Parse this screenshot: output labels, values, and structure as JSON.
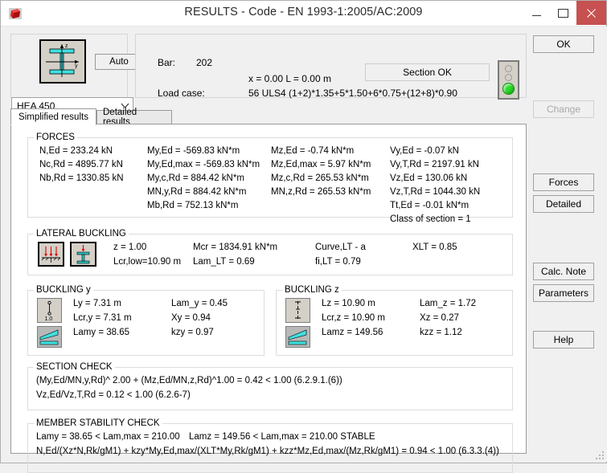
{
  "window": {
    "title": "RESULTS - Code - EN 1993-1:2005/AC:2009",
    "app_icon": "robot-structural-icon",
    "minimize": "—",
    "maximize": "▢",
    "close": "✕"
  },
  "section": {
    "profile_icon": "i-beam-section-icon",
    "auto_label": "Auto",
    "profile_value": "HEA 450",
    "chevron": "⌄"
  },
  "bar_info": {
    "bar_label": "Bar:",
    "bar_value": "202",
    "position": "x = 0.00 L = 0.00 m",
    "load_case_label": "Load case:",
    "load_case_value": "56 ULS4  (1+2)*1.35+5*1.50+6*0.75+(12+8)*0.90",
    "status": "Section OK",
    "traffic_light": "green"
  },
  "tabs": [
    {
      "label": "Simplified results",
      "active": true
    },
    {
      "label": "Detailed results",
      "active": false
    }
  ],
  "forces": {
    "title": "FORCES",
    "col1": [
      "N,Ed = 233.24 kN",
      "Nc,Rd = 4895.77 kN",
      "Nb,Rd = 1330.85 kN"
    ],
    "col2": [
      "My,Ed = -569.83 kN*m",
      "My,Ed,max = -569.83 kN*m",
      "My,c,Rd = 884.42 kN*m",
      "MN,y,Rd = 884.42 kN*m",
      "Mb,Rd = 752.13 kN*m"
    ],
    "col3": [
      "Mz,Ed = -0.74 kN*m",
      "Mz,Ed,max = 5.97 kN*m",
      "Mz,c,Rd = 265.53 kN*m",
      "MN,z,Rd = 265.53 kN*m"
    ],
    "col4": [
      "Vy,Ed = -0.07 kN",
      "Vy,T,Rd = 2197.91 kN",
      "Vz,Ed = 130.06 kN",
      "Vz,T,Rd = 1044.30 kN",
      "Tt,Ed = -0.01 kN*m",
      "Class of section = 1"
    ]
  },
  "lateral_buckling": {
    "title": "LATERAL BUCKLING",
    "icon_left": "lateral-load-diagram-icon",
    "icon_right": "i-section-restraint-icon",
    "col1": [
      "z = 1.00",
      "Lcr,low=10.90 m"
    ],
    "col2": [
      "Mcr = 1834.91 kN*m",
      "Lam_LT = 0.69"
    ],
    "col3": [
      "Curve,LT - a",
      "fi,LT = 0.79"
    ],
    "col4": [
      "XLT = 0.85"
    ]
  },
  "buckling_y": {
    "title": "BUCKLING y",
    "icon_top": "buckling-length-coefficient-icon",
    "icon_bottom": "buckling-moment-diagram-icon",
    "col1": [
      "Ly = 7.31 m",
      "Lcr,y = 7.31 m",
      "Lamy = 38.65"
    ],
    "col2": [
      "Lam_y = 0.45",
      "Xy = 0.94",
      "kzy = 0.97"
    ]
  },
  "buckling_z": {
    "title": "BUCKLING z",
    "icon_top": "buckling-length-coefficient-icon",
    "icon_bottom": "buckling-moment-diagram-icon",
    "col1": [
      "Lz = 10.90 m",
      "Lcr,z = 10.90 m",
      "Lamz = 149.56"
    ],
    "col2": [
      "Lam_z = 1.72",
      "Xz = 0.27",
      "kzz = 1.12"
    ]
  },
  "section_check": {
    "title": "SECTION CHECK",
    "lines": [
      "(My,Ed/MN,y,Rd)^ 2.00 + (Mz,Ed/MN,z,Rd)^1.00 = 0.42 < 1.00   (6.2.9.1.(6))",
      "Vz,Ed/Vz,T,Rd = 0.12 < 1.00   (6.2.6-7)"
    ]
  },
  "member_stability_check": {
    "title": "MEMBER STABILITY CHECK",
    "line1_a": "Lamy = 38.65 < Lam,max = 210.00",
    "line1_b": "Lamz = 149.56 < Lam,max = 210.00    STABLE",
    "line2": "N,Ed/(Xz*N,Rk/gM1) + kzy*My,Ed,max/(XLT*My,Rk/gM1) + kzz*Mz,Ed,max/(Mz,Rk/gM1) = 0.94 < 1.00   (6.3.3.(4))"
  },
  "buttons": {
    "ok": "OK",
    "change": "Change",
    "forces": "Forces",
    "detailed": "Detailed",
    "calc_note": "Calc. Note",
    "parameters": "Parameters",
    "help": "Help"
  },
  "colors": {
    "close_red": "#c75050",
    "green_light": "#27dd27",
    "cyan_flange": "#40e0e0",
    "red_arrow": "#e00000",
    "window_bg": "#f0f0f0"
  }
}
